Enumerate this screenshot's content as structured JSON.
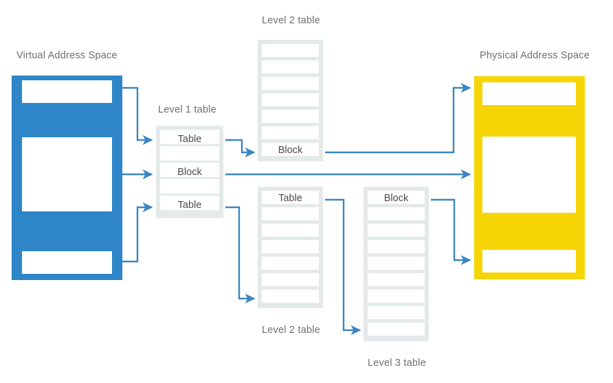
{
  "diagram": {
    "title_virtual": "Virtual Address Space",
    "title_physical": "Physical Address Space",
    "label_level1": "Level 1 table",
    "label_level2_top": "Level 2 table",
    "label_level2_bottom": "Level 2 table",
    "label_level3": "Level 3 table",
    "colors": {
      "virtual_blue": "#2E86C8",
      "physical_yellow": "#F5D505",
      "arrow_blue": "#3A86C0",
      "table_frame": "#e4eaea",
      "cell_white": "#ffffff",
      "label_gray": "#6e6e6e",
      "cell_text_gray": "#4a4a4a",
      "page_background": "#ffffff"
    },
    "level1_table": {
      "rows": [
        {
          "label": "Table"
        },
        {
          "label": ""
        },
        {
          "label": "Block"
        },
        {
          "label": ""
        },
        {
          "label": "Table"
        }
      ]
    },
    "level2_table_top": {
      "rows": [
        {
          "label": ""
        },
        {
          "label": ""
        },
        {
          "label": ""
        },
        {
          "label": ""
        },
        {
          "label": ""
        },
        {
          "label": ""
        },
        {
          "label": "Block"
        }
      ]
    },
    "level2_table_bottom": {
      "rows": [
        {
          "label": "Table"
        },
        {
          "label": ""
        },
        {
          "label": ""
        },
        {
          "label": ""
        },
        {
          "label": ""
        },
        {
          "label": ""
        },
        {
          "label": ""
        }
      ]
    },
    "level3_table": {
      "rows": [
        {
          "label": "Block"
        },
        {
          "label": ""
        },
        {
          "label": ""
        },
        {
          "label": ""
        },
        {
          "label": ""
        },
        {
          "label": ""
        },
        {
          "label": ""
        },
        {
          "label": ""
        },
        {
          "label": ""
        }
      ]
    },
    "virtual_address_space": {
      "regions": [
        {
          "name": "region-top"
        },
        {
          "name": "region-middle"
        },
        {
          "name": "region-bottom"
        }
      ]
    },
    "physical_address_space": {
      "regions": [
        {
          "name": "frame-top"
        },
        {
          "name": "frame-middle"
        },
        {
          "name": "frame-bottom"
        }
      ]
    }
  }
}
